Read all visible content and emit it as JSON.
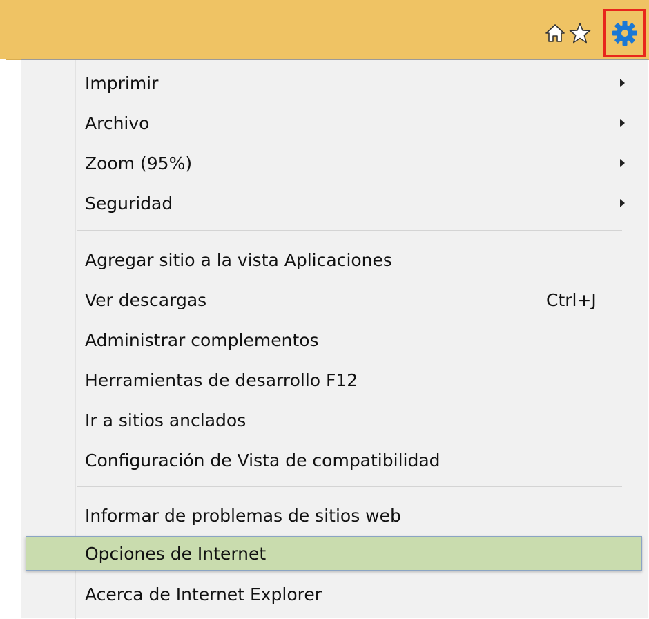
{
  "toolbar": {
    "icons": [
      "home-icon",
      "favorites-star-icon",
      "gear-icon"
    ],
    "background": "#efc364",
    "gear_color": "#1b78d4",
    "gear_highlight_border": "#e8261c"
  },
  "menu": {
    "groups": [
      {
        "items": [
          {
            "label": "Imprimir",
            "submenu": true
          },
          {
            "label": "Archivo",
            "submenu": true
          },
          {
            "label": "Zoom (95%)",
            "submenu": true
          },
          {
            "label": "Seguridad",
            "submenu": true
          }
        ]
      },
      {
        "items": [
          {
            "label": "Agregar sitio a la vista Aplicaciones"
          },
          {
            "label": "Ver descargas",
            "shortcut": "Ctrl+J"
          },
          {
            "label": "Administrar complementos"
          },
          {
            "label": "Herramientas de desarrollo F12"
          },
          {
            "label": "Ir a sitios anclados"
          },
          {
            "label": "Configuración de Vista de compatibilidad"
          }
        ]
      },
      {
        "items": [
          {
            "label": "Informar de problemas de sitios web"
          },
          {
            "label": "Opciones de Internet",
            "highlighted": true
          },
          {
            "label": "Acerca de Internet Explorer"
          }
        ]
      }
    ],
    "highlight_color": "#c9dcae"
  }
}
